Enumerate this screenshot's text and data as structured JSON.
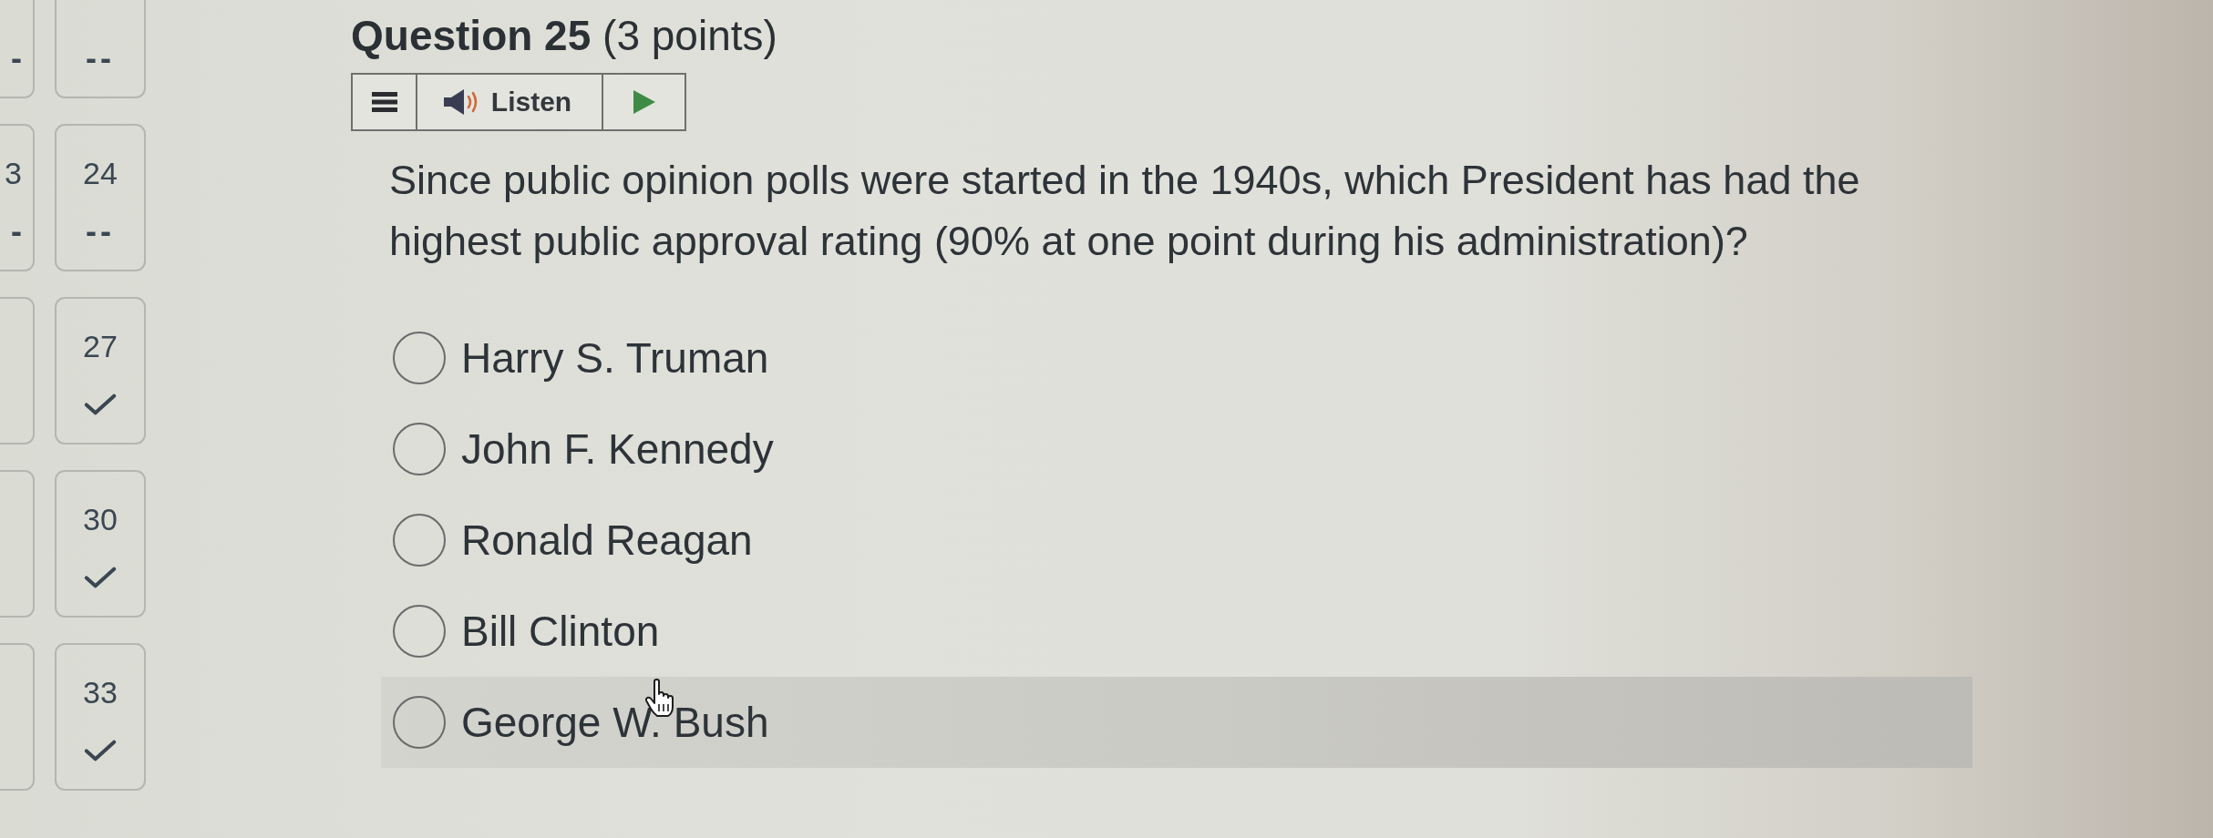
{
  "question_nav": {
    "partial_column": [
      {
        "status": "-"
      },
      {
        "number": "3",
        "status": "-"
      }
    ],
    "column": [
      {
        "answered": false,
        "status": "--"
      },
      {
        "number": "24",
        "answered": false,
        "status": "--"
      },
      {
        "number": "27",
        "answered": true
      },
      {
        "number": "30",
        "answered": true
      },
      {
        "number": "33",
        "answered": true
      }
    ]
  },
  "question": {
    "title": "**Question 25** (3 points)",
    "audio_toolbar": {
      "listen_label": "Listen"
    },
    "text": "Since public opinion polls were started in the 1940s, which President has had the highest public approval rating (90% at one point during his administration)?",
    "options": [
      {
        "label": "Harry S. Truman",
        "selected": false,
        "hovered": false
      },
      {
        "label": "John F. Kennedy",
        "selected": false,
        "hovered": false
      },
      {
        "label": "Ronald Reagan",
        "selected": false,
        "hovered": false
      },
      {
        "label": "Bill Clinton",
        "selected": false,
        "hovered": false
      },
      {
        "label": "George W. Bush",
        "selected": false,
        "hovered": true
      }
    ]
  }
}
